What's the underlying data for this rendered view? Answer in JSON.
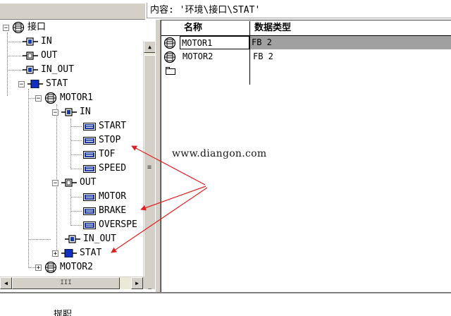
{
  "header": {
    "content_path": "内容: '环境\\接口\\STAT'"
  },
  "tree": {
    "items": [
      {
        "label": "接口",
        "icon": "fb-icon",
        "expander": "−"
      },
      {
        "label": "IN",
        "icon": "interface-icon"
      },
      {
        "label": "OUT",
        "icon": "interface-icon"
      },
      {
        "label": "IN_OUT",
        "icon": "interface-icon"
      },
      {
        "label": "STAT",
        "icon": "stat-icon",
        "expander": "−"
      },
      {
        "label": "MOTOR1",
        "icon": "fb-icon",
        "expander": "−"
      },
      {
        "label": "IN",
        "icon": "interface-icon",
        "expander": "−"
      },
      {
        "label": "START",
        "icon": "parameter-icon"
      },
      {
        "label": "STOP",
        "icon": "parameter-icon"
      },
      {
        "label": "TOF",
        "icon": "parameter-icon"
      },
      {
        "label": "SPEED",
        "icon": "parameter-icon"
      },
      {
        "label": "OUT",
        "icon": "interface-icon",
        "expander": "−"
      },
      {
        "label": "MOTOR",
        "icon": "parameter-icon"
      },
      {
        "label": "BRAKE",
        "icon": "parameter-icon"
      },
      {
        "label": "OVERSPE",
        "icon": "parameter-icon"
      },
      {
        "label": "IN_OUT",
        "icon": "interface-icon"
      },
      {
        "label": "STAT",
        "icon": "stat-icon",
        "expander": "+"
      },
      {
        "label": "MOTOR2",
        "icon": "fb-icon",
        "expander": "+"
      }
    ]
  },
  "scrollbars": {
    "vertical_grip": "≡",
    "horizontal_grip": "III",
    "up": "▲",
    "down": "▼",
    "left": "◀",
    "right": "▶"
  },
  "table": {
    "columns": [
      "名称",
      "数据类型"
    ],
    "rows": [
      {
        "name": "MOTOR1",
        "type": "FB 2",
        "icon": "fb-icon"
      },
      {
        "name": "MOTOR2",
        "type": "FB 2",
        "icon": "fb-icon"
      },
      {
        "name": "",
        "type": "",
        "icon": "new-row-icon"
      }
    ]
  },
  "annotation": {
    "watermark": "www.diangon.com",
    "arrow_color": "#e02020"
  },
  "footer": {
    "partial_text": "提职"
  },
  "colors": {
    "fb_icon_blue": "#1a3aa0",
    "stat_icon_blue": "#1030c0",
    "highlight_gray": "#a0a0a0",
    "chrome_gray": "#d4d0c8"
  }
}
